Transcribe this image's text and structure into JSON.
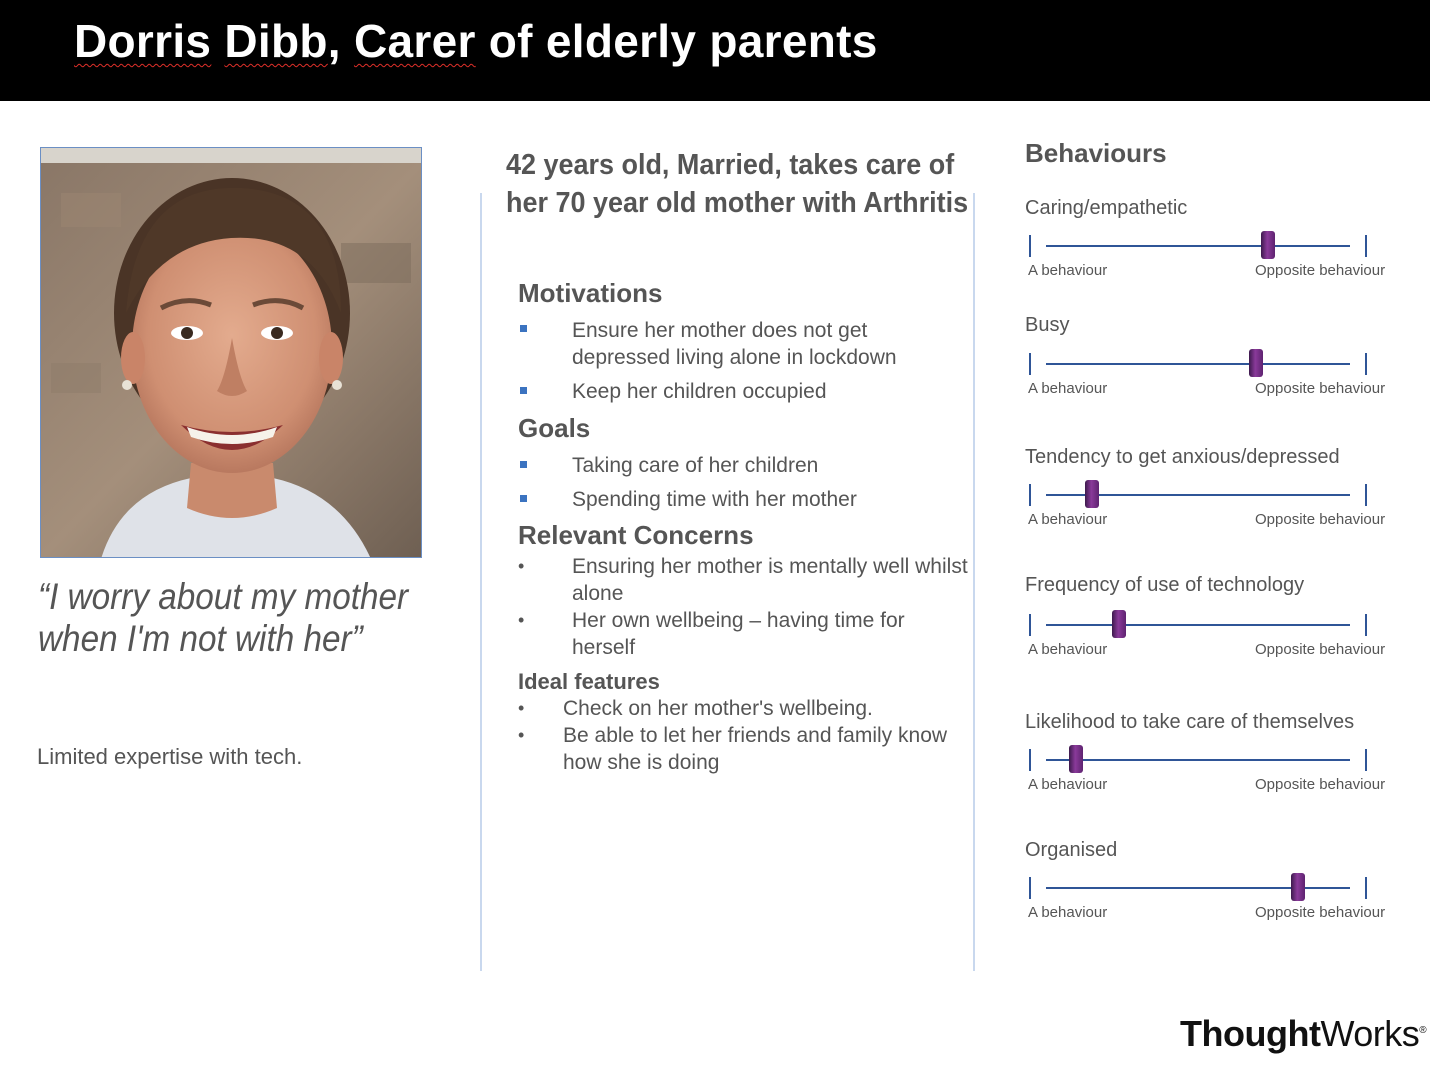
{
  "header": {
    "name_first": "Dorris",
    "name_last": "Dibb",
    "role_word": "Carer",
    "role_rest": "of elderly parents"
  },
  "quote": "“I worry about my mother when I'm not with her”",
  "tech_note": "Limited expertise with tech.",
  "summary": {
    "line1": "42 years old, Married, takes care of",
    "line2": "her 70 year old mother with Arthritis"
  },
  "motivations": {
    "title": "Motivations",
    "items": [
      {
        "line1": "Ensure her mother does not get",
        "line2": "depressed living alone in lockdown"
      },
      {
        "line1": "Keep her children occupied",
        "line2": ""
      }
    ]
  },
  "goals": {
    "title": "Goals",
    "items": [
      "Taking care of her children",
      "Spending time with her mother"
    ]
  },
  "concerns": {
    "title": "Relevant Concerns",
    "items": [
      {
        "line1": "Ensuring her mother is mentally well whilst",
        "line2": "alone"
      },
      {
        "line1": "Her own wellbeing – having time for",
        "line2": "herself"
      }
    ]
  },
  "features": {
    "title": "Ideal features",
    "items": [
      {
        "line1": "Check on her mother's wellbeing.",
        "line2": ""
      },
      {
        "line1": "Be able to let her friends and family know",
        "line2": "how she is doing"
      }
    ]
  },
  "behaviours": {
    "title": "Behaviours",
    "left_label": "A behaviour",
    "right_label": "Opposite behaviour",
    "scale_color": "#2f5597",
    "knob_color": "#6a2a7e",
    "items": [
      {
        "label": "Caring/empathetic",
        "value": 0.73
      },
      {
        "label": "Busy",
        "value": 0.69
      },
      {
        "label": "Tendency to get anxious/depressed",
        "value": 0.15
      },
      {
        "label": "Frequency of use of technology",
        "value": 0.24
      },
      {
        "label": "Likelihood to take care of themselves",
        "value": 0.1
      },
      {
        "label": "Organised",
        "value": 0.83
      }
    ]
  },
  "logo": {
    "bold": "Thought",
    "light": "Works",
    "reg": "®"
  }
}
